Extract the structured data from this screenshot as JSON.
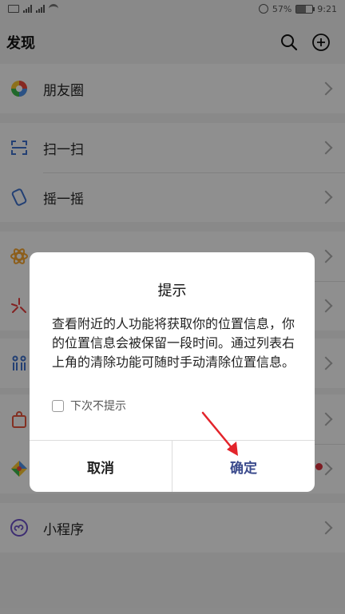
{
  "status_bar": {
    "battery": "57%",
    "battery_level": 0.57,
    "time": "9:21"
  },
  "header": {
    "title": "发现"
  },
  "list": {
    "moments": "朋友圈",
    "scan": "扫一扫",
    "shake": "摇一摇",
    "hidden_1": "",
    "hidden_2": "",
    "hidden_3": "",
    "hidden_4": "",
    "hidden_5": "",
    "mini_programs": "小程序"
  },
  "dialog": {
    "title": "提示",
    "message": "查看附近的人功能将获取你的位置信息，你的位置信息会被保留一段时间。通过列表右上角的清除功能可随时手动清除位置信息。",
    "checkbox_label": "下次不提示",
    "cancel_label": "取消",
    "confirm_label": "确定"
  },
  "colors": {
    "confirm": "#3a4a8c",
    "arrow": "#e3242b",
    "red_dot": "#d6303c"
  }
}
